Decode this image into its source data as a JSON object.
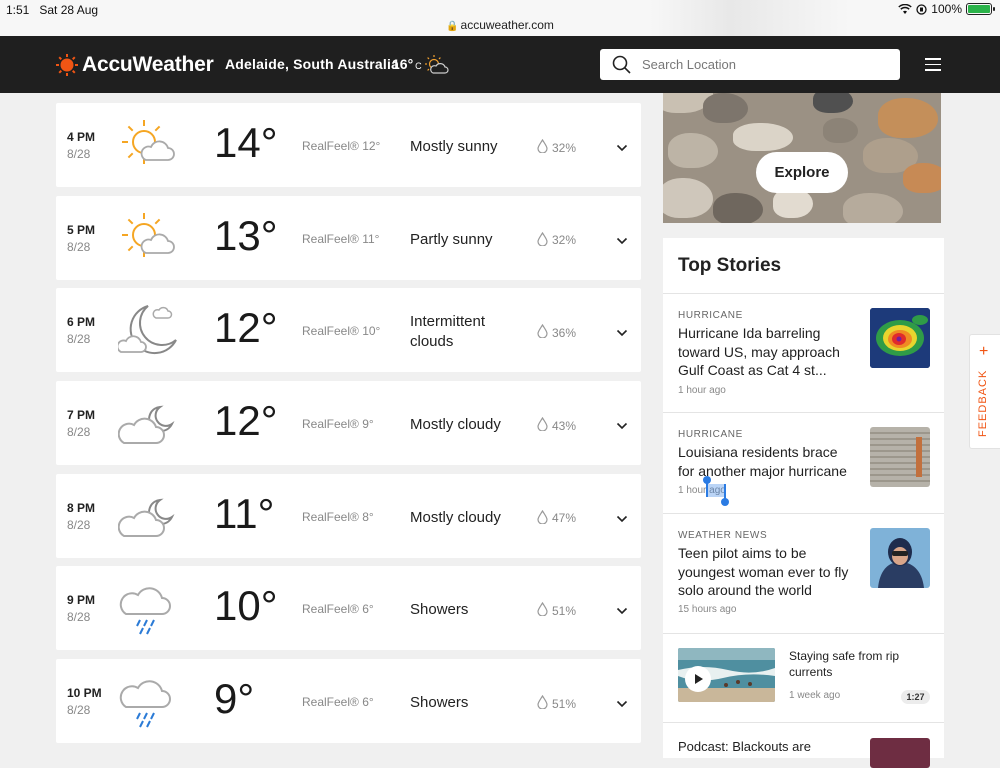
{
  "status_bar": {
    "time": "1:51",
    "date": "Sat 28 Aug",
    "url": "accuweather.com",
    "battery": "100%"
  },
  "header": {
    "logo": "AccuWeather",
    "location": "Adelaide, South Australia",
    "temp": "16°",
    "unit": "C",
    "search_placeholder": "Search Location",
    "brand_color": "#f05514"
  },
  "hourly": [
    {
      "time": "4 PM",
      "date": "8/28",
      "temp": "14°",
      "realfeel": "RealFeel® 12°",
      "phrase": "Mostly sunny",
      "precip": "32%",
      "icon": "sun-cloud-icon"
    },
    {
      "time": "5 PM",
      "date": "8/28",
      "temp": "13°",
      "realfeel": "RealFeel® 11°",
      "phrase": "Partly sunny",
      "precip": "32%",
      "icon": "sun-cloud-icon"
    },
    {
      "time": "6 PM",
      "date": "8/28",
      "temp": "12°",
      "realfeel": "RealFeel® 10°",
      "phrase": "Intermittent clouds",
      "precip": "36%",
      "icon": "moon-cloud-icon"
    },
    {
      "time": "7 PM",
      "date": "8/28",
      "temp": "12°",
      "realfeel": "RealFeel® 9°",
      "phrase": "Mostly cloudy",
      "precip": "43%",
      "icon": "cloud-moon-icon"
    },
    {
      "time": "8 PM",
      "date": "8/28",
      "temp": "11°",
      "realfeel": "RealFeel® 8°",
      "phrase": "Mostly cloudy",
      "precip": "47%",
      "icon": "cloud-moon-icon"
    },
    {
      "time": "9 PM",
      "date": "8/28",
      "temp": "10°",
      "realfeel": "RealFeel® 6°",
      "phrase": "Showers",
      "precip": "51%",
      "icon": "rain-cloud-icon"
    },
    {
      "time": "10 PM",
      "date": "8/28",
      "temp": "9°",
      "realfeel": "RealFeel® 6°",
      "phrase": "Showers",
      "precip": "51%",
      "icon": "rain-cloud-icon"
    }
  ],
  "promo": {
    "button": "Explore"
  },
  "top_stories": {
    "title": "Top Stories",
    "items": [
      {
        "category": "HURRICANE",
        "headline": "Hurricane Ida barreling toward US, may approach Gulf Coast as Cat 4 st...",
        "time": "1 hour ago"
      },
      {
        "category": "HURRICANE",
        "headline": "Louisiana residents brace for another major hurricane",
        "time": "1 hour ago"
      },
      {
        "category": "WEATHER NEWS",
        "headline": "Teen pilot aims to be youngest woman ever to fly solo around the world",
        "time": "15 hours ago"
      }
    ],
    "video": {
      "headline": "Staying safe from rip currents",
      "time": "1 week ago",
      "duration": "1:27"
    },
    "next_headline": "Podcast: Blackouts are"
  },
  "feedback": {
    "label": "FEEDBACK",
    "plus": "+"
  }
}
